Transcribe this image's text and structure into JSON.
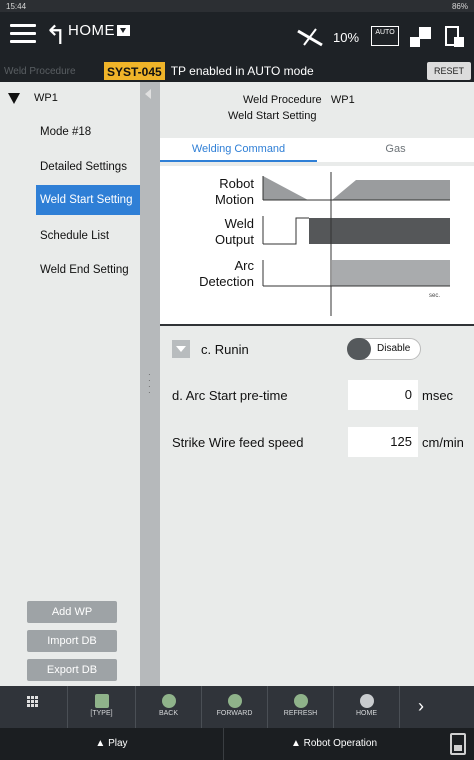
{
  "status_bar": {
    "time": "15:44",
    "battery": "86%"
  },
  "header": {
    "title": "HOME",
    "speed": "10%",
    "mode_badge": "AUTO"
  },
  "alarm": {
    "context": "Weld Procedure",
    "code": "SYST-045",
    "message": "TP enabled in AUTO mode",
    "reset_label": "RESET"
  },
  "sidebar": {
    "title": "WP1",
    "items": [
      {
        "label": "Mode #18"
      },
      {
        "label": "Detailed Settings"
      },
      {
        "label": "Weld Start Setting"
      },
      {
        "label": "Schedule List"
      },
      {
        "label": "Weld End Setting"
      }
    ],
    "buttons": {
      "add": "Add WP",
      "import": "Import DB",
      "export": "Export DB"
    }
  },
  "main": {
    "procedure_label": "Weld Procedure",
    "procedure_value": "WP1",
    "subtitle": "Weld Start Setting",
    "tabs": [
      {
        "label": "Welding Command"
      },
      {
        "label": "Gas"
      }
    ],
    "diagram": {
      "robot_motion": [
        "Robot",
        "Motion"
      ],
      "weld_output": [
        "Weld",
        "Output"
      ],
      "arc_detection": [
        "Arc",
        "Detection"
      ],
      "time_unit": "sec."
    },
    "runin": {
      "label": "c.  Runin",
      "toggle_value": "Disable"
    },
    "arc_start_pretime": {
      "label": "d.  Arc Start pre-time",
      "value": "0",
      "unit": "msec"
    },
    "strike_wire_feed": {
      "label": "Strike Wire feed speed",
      "value": "125",
      "unit": "cm/min"
    }
  },
  "toolbar": {
    "type": "[TYPE]",
    "back": "BACK",
    "forward": "FORWARD",
    "refresh": "REFRESH",
    "home": "HOME"
  },
  "footer": {
    "play": "▲ Play",
    "robot_operation": "▲ Robot Operation"
  },
  "colors": {
    "accent": "#2f7fd6",
    "alarm_badge": "#f0b429",
    "diagram_fill": "#9a9c9e",
    "diagram_dark": "#555759"
  }
}
